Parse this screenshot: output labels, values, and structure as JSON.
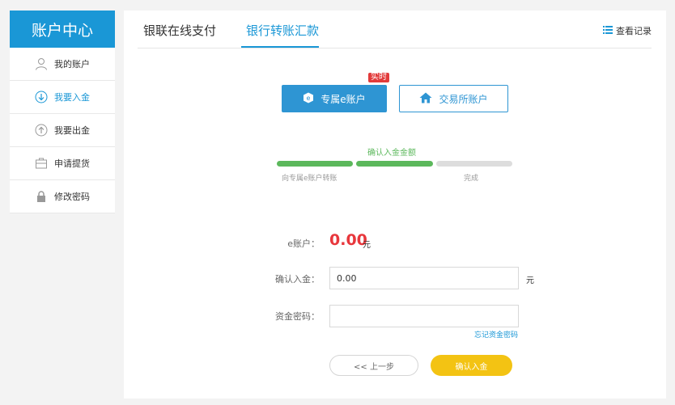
{
  "sidebar": {
    "title": "账户中心",
    "items": [
      {
        "label": "我的账户",
        "icon": "user-icon"
      },
      {
        "label": "我要入金",
        "icon": "arrow-down-circle-icon"
      },
      {
        "label": "我要出金",
        "icon": "arrow-up-circle-icon"
      },
      {
        "label": "申请提货",
        "icon": "briefcase-icon"
      },
      {
        "label": "修改密码",
        "icon": "lock-icon"
      }
    ],
    "active_index": 1
  },
  "tabs": [
    {
      "label": "银联在线支付"
    },
    {
      "label": "银行转账汇款"
    }
  ],
  "active_tab": 1,
  "records_label": "查看记录",
  "account_type": {
    "badge": "实时",
    "exclusive_label": "专属e账户",
    "exchange_label": "交易所账户"
  },
  "steps": {
    "current_label": "确认入金金额",
    "labels": [
      "向专属e账户转账",
      "完成"
    ],
    "completed": 2,
    "total": 3
  },
  "form": {
    "balance_label": "e账户：",
    "balance_value": "0.00",
    "balance_unit": "元",
    "amount_label": "确认入金：",
    "amount_value": "0.00",
    "amount_unit": "元",
    "password_label": "资金密码：",
    "password_value": "",
    "forgot_label": "忘记资金密码"
  },
  "buttons": {
    "prev_label": "<< 上一步",
    "confirm_label": "确认入金"
  },
  "colors": {
    "brand": "#1a97d6",
    "button_blue": "#2e95d3",
    "step_done": "#5cb85c",
    "step_todo": "#dddddd",
    "amount_red": "#e8373c",
    "confirm_yellow": "#f3c313",
    "badge_red": "#e23b3b"
  }
}
